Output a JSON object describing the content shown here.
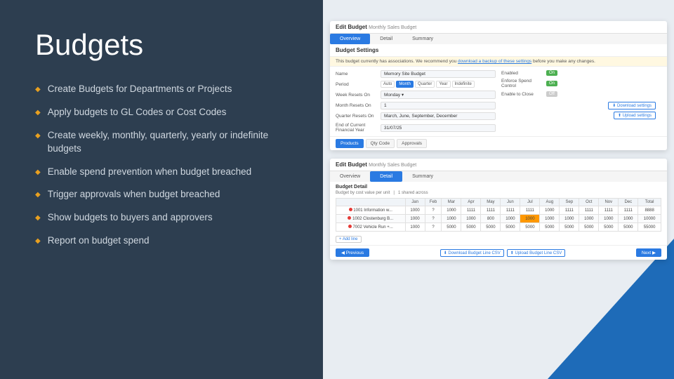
{
  "page": {
    "title": "Budgets"
  },
  "left": {
    "bullets": [
      "Create Budgets for Departments or Projects",
      "Apply budgets to GL Codes or Cost Codes",
      "Create weekly, monthly, quarterly, yearly or indefinite budgets",
      "Enable spend prevention when budget breached",
      "Trigger approvals when budget breached",
      "Show budgets to buyers and approvers",
      "Report on budget spend"
    ]
  },
  "top_card": {
    "title": "Edit Budget",
    "subtitle": "Monthly Sales Budget",
    "tabs": [
      "Overview",
      "Detail",
      "Summary"
    ],
    "active_tab": "Overview",
    "section_title": "Budget Settings",
    "notice": "This budget currently has associations. We recommend you download a backup of these settings before you make any changes.",
    "fields": {
      "name_label": "Memory Site Budget",
      "period_label": "Period",
      "period_options": [
        "Auto",
        "Month",
        "Quarter",
        "Year",
        "Indefinite"
      ],
      "active_period": "Month",
      "week_resets_label": "Week Resets On",
      "week_resets_value": "Monday",
      "month_resets_label": "Month Resets On",
      "month_resets_value": "1",
      "quarter_resets_label": "Quarter Resets On",
      "quarter_resets_value": "March, June, September, December",
      "end_label": "End of Current Financial Year",
      "enabled_label": "Enabled",
      "enabled_value": "On",
      "enforce_spend_label": "Enforce Spend Control",
      "enforce_spend_value": "On",
      "enable_to_close_label": "Enable To Close",
      "enable_to_close_value": "Off"
    },
    "action_buttons": [
      "Download settings",
      "Upload settings"
    ],
    "tabs2": [
      "Products",
      "Qty Code",
      "Approvals"
    ]
  },
  "bottom_card": {
    "title": "Edit Budget",
    "subtitle": "Monthly Sales Budget",
    "tabs": [
      "Overview",
      "Detail",
      "Summary"
    ],
    "active_tab": "Overview",
    "section_title": "Budget Detail",
    "sub_label": "Budget by cost value per unit",
    "shared_label": "1 shared across",
    "columns": [
      "",
      "Jan",
      "Feb",
      "Mar",
      "Apr",
      "May",
      "Jun",
      "Jul",
      "Aug",
      "Sep",
      "Oct",
      "Nov",
      "Dec",
      "Total"
    ],
    "rows": [
      {
        "name": "1001 Information w...",
        "values": [
          "1000",
          "?",
          "1000",
          "1111",
          "1111",
          "1111",
          "1111",
          "1000",
          "1111",
          "1111",
          "1111",
          "1111",
          "1111",
          "8888"
        ],
        "highlight_col": null
      },
      {
        "name": "1002 Clostenburg B...",
        "values": [
          "1000",
          "?",
          "1000",
          "1000",
          "800",
          "1000",
          "1000",
          "1000",
          "1000",
          "1000",
          "1000",
          "1000",
          "1000",
          "10000"
        ],
        "highlight_col": 7
      },
      {
        "name": "7002 Vehicle Run +...",
        "values": [
          "1000",
          "?",
          "5000",
          "5000",
          "5000",
          "5000",
          "5000",
          "5000",
          "5000",
          "5000",
          "5000",
          "5000",
          "5000",
          "55000"
        ],
        "highlight_col": null
      }
    ],
    "add_row_label": "+ Add line",
    "csv_buttons": [
      "Download Budget Line CSV",
      "Upload Budget Line CSV"
    ],
    "prev_label": "Previous",
    "next_label": "Next"
  }
}
